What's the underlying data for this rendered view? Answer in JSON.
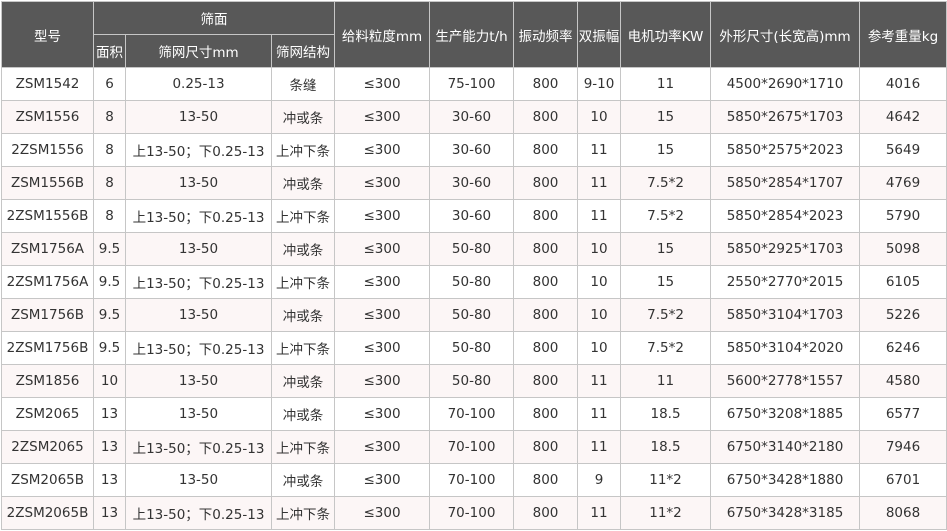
{
  "header": {
    "model": "型号",
    "screen_surface": "筛面",
    "area": "面积",
    "mesh_size": "筛网尺寸mm",
    "mesh_structure": "筛网结构",
    "feed_size": "给料粒度mm",
    "capacity": "生产能力t/h",
    "frequency": "振动频率",
    "amplitude": "双振幅",
    "motor_power": "电机功率KW",
    "dimensions": "外形尺寸(长宽高)mm",
    "weight": "参考重量kg"
  },
  "rows": [
    [
      "ZSM1542",
      "6",
      "0.25-13",
      "条缝",
      "≤300",
      "75-100",
      "800",
      "9-10",
      "11",
      "4500*2690*1710",
      "4016"
    ],
    [
      "ZSM1556",
      "8",
      "13-50",
      "冲或条",
      "≤300",
      "30-60",
      "800",
      "10",
      "15",
      "5850*2675*1703",
      "4642"
    ],
    [
      "2ZSM1556",
      "8",
      "上13-50；下0.25-13",
      "上冲下条",
      "≤300",
      "30-60",
      "800",
      "11",
      "15",
      "5850*2575*2023",
      "5649"
    ],
    [
      "ZSM1556B",
      "8",
      "13-50",
      "冲或条",
      "≤300",
      "30-60",
      "800",
      "11",
      "7.5*2",
      "5850*2854*1707",
      "4769"
    ],
    [
      "2ZSM1556B",
      "8",
      "上13-50；下0.25-13",
      "上冲下条",
      "≤300",
      "30-60",
      "800",
      "11",
      "7.5*2",
      "5850*2854*2023",
      "5790"
    ],
    [
      "ZSM1756A",
      "9.5",
      "13-50",
      "冲或条",
      "≤300",
      "50-80",
      "800",
      "10",
      "15",
      "5850*2925*1703",
      "5098"
    ],
    [
      "2ZSM1756A",
      "9.5",
      "上13-50；下0.25-13",
      "上冲下条",
      "≤300",
      "50-80",
      "800",
      "10",
      "15",
      "2550*2770*2015",
      "6105"
    ],
    [
      "ZSM1756B",
      "9.5",
      "13-50",
      "冲或条",
      "≤300",
      "50-80",
      "800",
      "10",
      "7.5*2",
      "5850*3104*1703",
      "5226"
    ],
    [
      "2ZSM1756B",
      "9.5",
      "上13-50；下0.25-13",
      "上冲下条",
      "≤300",
      "50-80",
      "800",
      "10",
      "7.5*2",
      "5850*3104*2020",
      "6246"
    ],
    [
      "ZSM1856",
      "10",
      "13-50",
      "冲或条",
      "≤300",
      "50-80",
      "800",
      "11",
      "11",
      "5600*2778*1557",
      "4580"
    ],
    [
      "ZSM2065",
      "13",
      "13-50",
      "冲或条",
      "≤300",
      "70-100",
      "800",
      "11",
      "18.5",
      "6750*3208*1885",
      "6577"
    ],
    [
      "2ZSM2065",
      "13",
      "上13-50；下0.25-13",
      "上冲下条",
      "≤300",
      "70-100",
      "800",
      "11",
      "18.5",
      "6750*3140*2180",
      "7946"
    ],
    [
      "ZSM2065B",
      "13",
      "13-50",
      "冲或条",
      "≤300",
      "70-100",
      "800",
      "9",
      "11*2",
      "6750*3428*1880",
      "6701"
    ],
    [
      "2ZSM2065B",
      "13",
      "上13-50；下0.25-13",
      "上冲下条",
      "≤300",
      "70-100",
      "800",
      "11",
      "11*2",
      "6750*3428*3185",
      "8068"
    ]
  ],
  "colors": {
    "header_bg": "#585858",
    "header_text": "#ffffff",
    "border": "#c6c6c6",
    "stripe": "#fcf6f6",
    "body_text": "#333333"
  }
}
